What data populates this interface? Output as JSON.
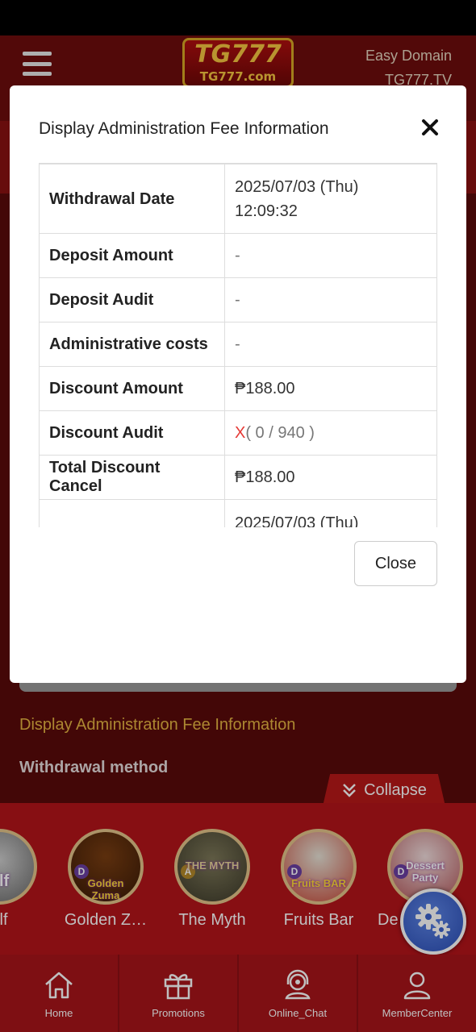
{
  "header": {
    "logo_main": "TG777",
    "logo_sub": "TG777.com",
    "domain_line1": "Easy Domain",
    "domain_line2": "TG777.TV"
  },
  "page": {
    "section_title": "Display Administration Fee Information",
    "withdrawal_method": "Withdrawal method",
    "collapse_label": "Collapse"
  },
  "modal": {
    "title": "Display Administration Fee Information",
    "rows": [
      {
        "label": "Withdrawal Date",
        "value_line1": "2025/07/03 (Thu)",
        "value_line2": "12:09:32"
      },
      {
        "label": "Deposit Amount",
        "value": "-"
      },
      {
        "label": "Deposit Audit",
        "value": "-"
      },
      {
        "label": "Administrative costs",
        "value": "-"
      },
      {
        "label": "Discount Amount",
        "value": "₱188.00"
      },
      {
        "label": "Discount Audit",
        "value_mark": "X",
        "value_rest": "( 0 / 940 )"
      },
      {
        "label": "Total Discount Cancel",
        "value": "₱188.00"
      },
      {
        "label": "",
        "value": "2025/07/03 (Thu)"
      }
    ],
    "close_label": "Close"
  },
  "games": [
    {
      "label": "olf",
      "icon_text": "olf"
    },
    {
      "label": "Golden Z…",
      "icon_text": "Golden Zuma"
    },
    {
      "label": "The Myth",
      "icon_text": "THE MYTH"
    },
    {
      "label": "Fruits Bar",
      "icon_text": "Fruits BAR"
    },
    {
      "label": "De",
      "icon_text": "Dessert Party"
    }
  ],
  "nav": [
    {
      "label": "Home",
      "icon": "home-icon"
    },
    {
      "label": "Promotions",
      "icon": "gift-icon"
    },
    {
      "label": "Online_Chat",
      "icon": "headset-icon"
    },
    {
      "label": "MemberCenter",
      "icon": "user-icon"
    }
  ],
  "colors": {
    "accent_gold": "#e6b542",
    "nav_red": "#a8141a",
    "alert_red": "#e53935"
  }
}
